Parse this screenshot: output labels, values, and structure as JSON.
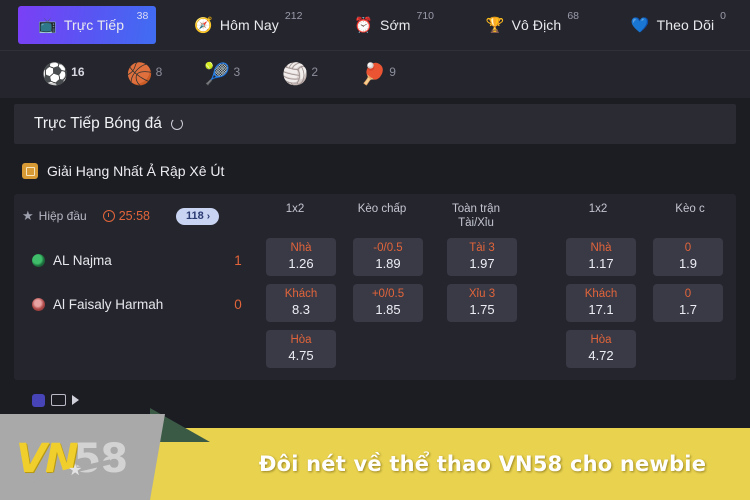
{
  "nav": {
    "tabs": [
      {
        "label": "Trực Tiếp",
        "count": "38",
        "icon": "live-video-icon",
        "glyph": "📺",
        "active": true
      },
      {
        "label": "Hôm Nay",
        "count": "212",
        "icon": "compass-icon",
        "glyph": "🧭",
        "active": false
      },
      {
        "label": "Sớm",
        "count": "710",
        "icon": "alarm-clock-icon",
        "glyph": "⏰",
        "active": false
      },
      {
        "label": "Vô Địch",
        "count": "68",
        "icon": "trophy-icon",
        "glyph": "🏆",
        "active": false
      },
      {
        "label": "Theo Dõi",
        "count": "0",
        "icon": "heart-shield-icon",
        "glyph": "💙",
        "active": false
      }
    ]
  },
  "sports": [
    {
      "name": "soccer",
      "glyph": "⚽",
      "count": "16",
      "selected": true
    },
    {
      "name": "basketball",
      "glyph": "🏀",
      "count": "8",
      "selected": false
    },
    {
      "name": "tennis",
      "glyph": "🎾",
      "count": "3",
      "selected": false
    },
    {
      "name": "volleyball",
      "glyph": "🏐",
      "count": "2",
      "selected": false
    },
    {
      "name": "table-tennis",
      "glyph": "🏓",
      "count": "9",
      "selected": false
    }
  ],
  "section": {
    "title": "Trực Tiếp Bóng đá",
    "spinner": "refresh-spinner-icon"
  },
  "league": {
    "name": "Giải Hạng Nhất Ả Rập Xê Út",
    "icon": "league-badge-icon",
    "color": "#d79a34"
  },
  "match": {
    "period_label": "Hiệp đầu",
    "star_icon": "star-icon",
    "clock_icon": "clock-icon",
    "time": "25:58",
    "markets_badge": "118",
    "markets_chevron": "›",
    "columns": [
      {
        "label": "1x2",
        "sub": ""
      },
      {
        "label": "Kèo chấp",
        "sub": ""
      },
      {
        "label": "Tài/Xỉu",
        "sub": "Toàn trận"
      },
      {
        "label": "1x2",
        "sub": ""
      },
      {
        "label": "Kèo c",
        "sub": ""
      }
    ],
    "teams": [
      {
        "name": "AL Najma",
        "score": "1",
        "badge": "green"
      },
      {
        "name": "Al Faisaly Harmah",
        "score": "0",
        "badge": "red"
      }
    ],
    "odds": {
      "group1": {
        "col1": [
          {
            "top": "Nhà",
            "bottom": "1.26"
          },
          {
            "top": "Khách",
            "bottom": "8.3"
          },
          {
            "top": "Hòa",
            "bottom": "4.75"
          }
        ],
        "col2": [
          {
            "top": "-0/0.5",
            "bottom": "1.89"
          },
          {
            "top": "+0/0.5",
            "bottom": "1.85"
          }
        ],
        "col3": [
          {
            "top": "Tài 3",
            "bottom": "1.97"
          },
          {
            "top": "Xỉu 3",
            "bottom": "1.75"
          }
        ]
      },
      "group2": {
        "col1": [
          {
            "top": "Nhà",
            "bottom": "1.17"
          },
          {
            "top": "Khách",
            "bottom": "17.1"
          },
          {
            "top": "Hòa",
            "bottom": "4.72"
          }
        ],
        "col2": [
          {
            "top": "0",
            "bottom": "1.9"
          },
          {
            "top": "0",
            "bottom": "1.7"
          }
        ]
      }
    }
  },
  "next_row": {
    "label": ""
  },
  "banner": {
    "logo_primary": "VN",
    "logo_secondary": "58",
    "star": "★",
    "title": "Đôi nét về thể thao VN58 cho newbie",
    "band_color": "#e8d24e",
    "logo_color": "#f0cf2c"
  }
}
